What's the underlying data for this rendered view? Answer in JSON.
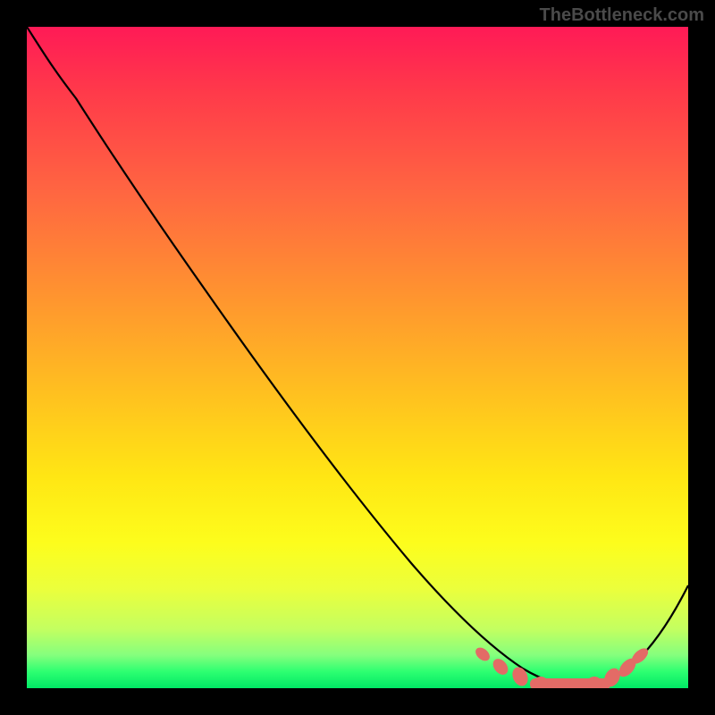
{
  "watermark": "TheBottleneck.com",
  "chart_data": {
    "type": "line",
    "title": "",
    "xlabel": "",
    "ylabel": "",
    "xlim": [
      0,
      100
    ],
    "ylim": [
      0,
      100
    ],
    "grid": false,
    "legend": false,
    "series": [
      {
        "name": "bottleneck-curve",
        "x": [
          0,
          3,
          8,
          15,
          25,
          35,
          45,
          55,
          62,
          67,
          71,
          74,
          77,
          80,
          83,
          86,
          89,
          92,
          95,
          100
        ],
        "y": [
          100,
          97,
          93,
          85,
          72,
          58,
          45,
          31,
          22,
          15,
          10,
          6,
          3,
          1,
          0.5,
          1,
          3,
          8,
          15,
          28
        ]
      }
    ],
    "markers": {
      "name": "optimal-range",
      "x": [
        67,
        70,
        73,
        75,
        77,
        79,
        81,
        83,
        85,
        87,
        89,
        91
      ],
      "y": [
        12,
        8,
        5,
        3.5,
        2.5,
        1.5,
        1,
        1,
        1.5,
        2.5,
        5,
        9
      ]
    },
    "gradient_colors": {
      "top": "#ff1a56",
      "mid": "#ffe614",
      "bottom": "#00e865"
    }
  }
}
